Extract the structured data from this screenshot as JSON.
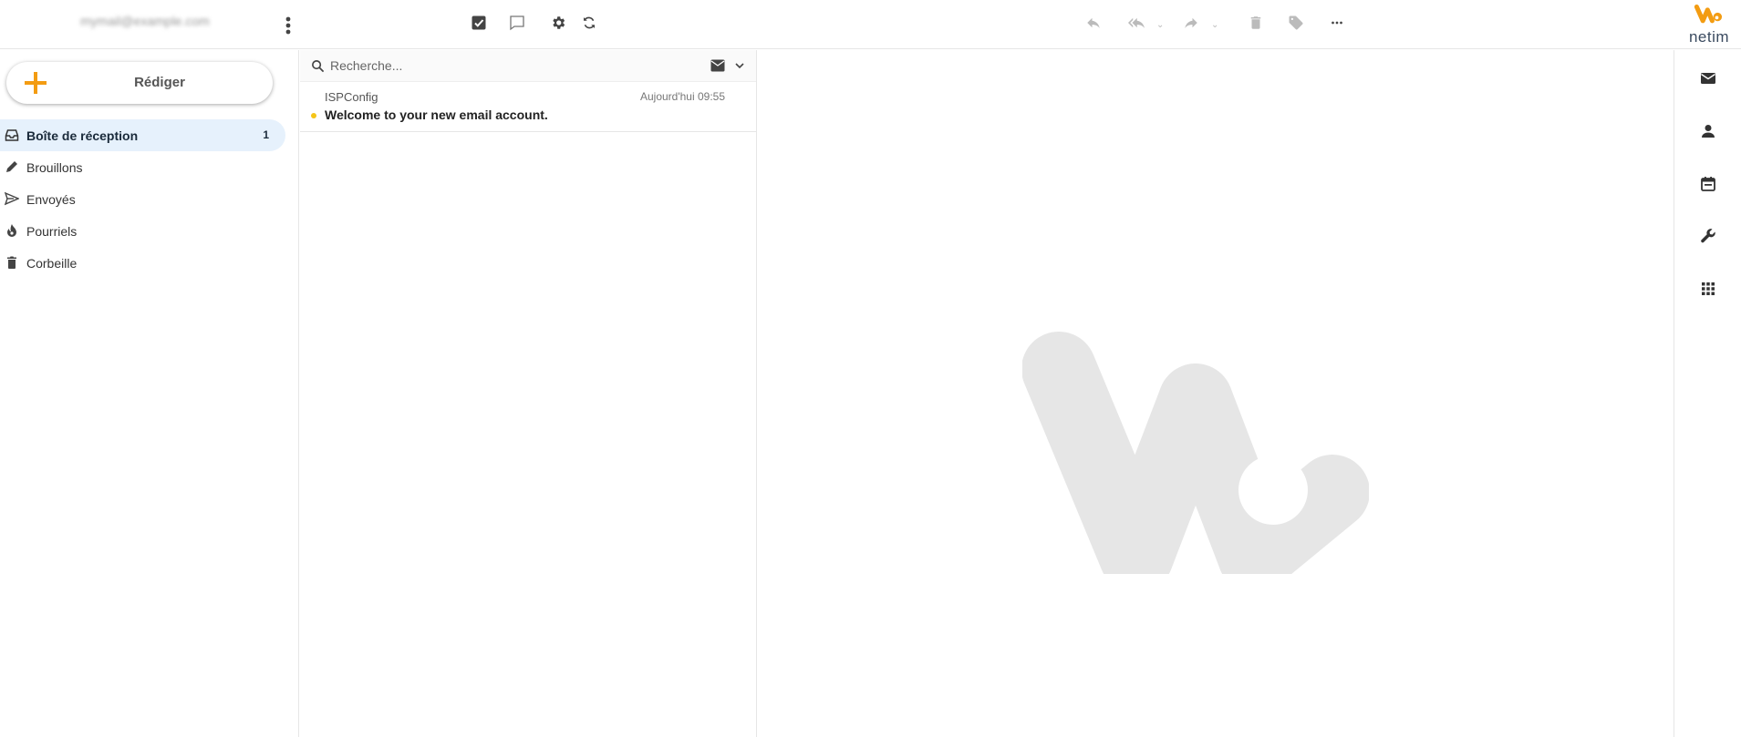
{
  "header": {
    "account": "mymail@example.com"
  },
  "compose": {
    "label": "Rédiger"
  },
  "folders": [
    {
      "label": "Boîte de réception",
      "count": "1",
      "icon": "inbox-icon",
      "active": true
    },
    {
      "label": "Brouillons",
      "count": "",
      "icon": "pencil-icon",
      "active": false
    },
    {
      "label": "Envoyés",
      "count": "",
      "icon": "send-icon",
      "active": false
    },
    {
      "label": "Pourriels",
      "count": "",
      "icon": "fire-icon",
      "active": false
    },
    {
      "label": "Corbeille",
      "count": "",
      "icon": "trash-icon",
      "active": false
    }
  ],
  "search": {
    "placeholder": "Recherche..."
  },
  "messages": [
    {
      "from": "ISPConfig",
      "date": "Aujourd'hui 09:55",
      "subject": "Welcome to your new email account.",
      "unread": true
    }
  ],
  "logo": {
    "text": "netim"
  },
  "colors": {
    "accent": "#f39c12",
    "active_bg": "#e6f1fc",
    "unread_dot": "#f5c518"
  }
}
